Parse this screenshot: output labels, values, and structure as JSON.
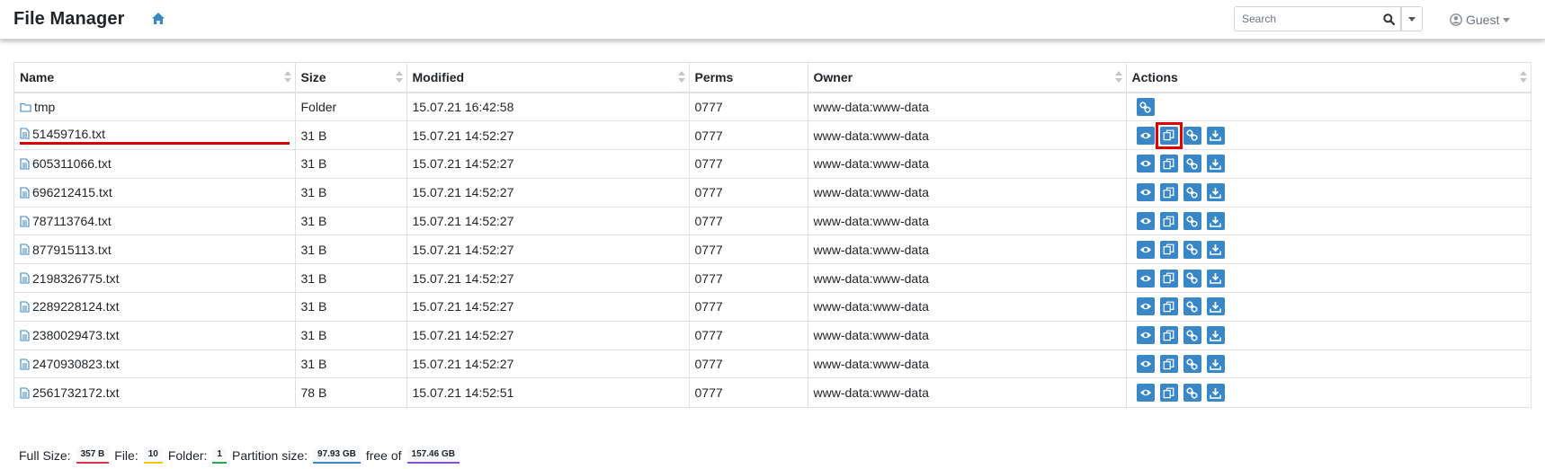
{
  "navbar": {
    "brand": "File Manager",
    "search_placeholder": "Search",
    "user_label": "Guest"
  },
  "table": {
    "headers": [
      "Name",
      "Size",
      "Modified",
      "Perms",
      "Owner",
      "Actions"
    ],
    "rows": [
      {
        "name": "tmp",
        "type": "folder",
        "size": "Folder",
        "modified": "15.07.21 16:42:58",
        "perms": "0777",
        "owner": "www-data:www-data"
      },
      {
        "name": "51459716.txt",
        "type": "file",
        "size": "31 B",
        "modified": "15.07.21 14:52:27",
        "perms": "0777",
        "owner": "www-data:www-data"
      },
      {
        "name": "605311066.txt",
        "type": "file",
        "size": "31 B",
        "modified": "15.07.21 14:52:27",
        "perms": "0777",
        "owner": "www-data:www-data"
      },
      {
        "name": "696212415.txt",
        "type": "file",
        "size": "31 B",
        "modified": "15.07.21 14:52:27",
        "perms": "0777",
        "owner": "www-data:www-data"
      },
      {
        "name": "787113764.txt",
        "type": "file",
        "size": "31 B",
        "modified": "15.07.21 14:52:27",
        "perms": "0777",
        "owner": "www-data:www-data"
      },
      {
        "name": "877915113.txt",
        "type": "file",
        "size": "31 B",
        "modified": "15.07.21 14:52:27",
        "perms": "0777",
        "owner": "www-data:www-data"
      },
      {
        "name": "2198326775.txt",
        "type": "file",
        "size": "31 B",
        "modified": "15.07.21 14:52:27",
        "perms": "0777",
        "owner": "www-data:www-data"
      },
      {
        "name": "2289228124.txt",
        "type": "file",
        "size": "31 B",
        "modified": "15.07.21 14:52:27",
        "perms": "0777",
        "owner": "www-data:www-data"
      },
      {
        "name": "2380029473.txt",
        "type": "file",
        "size": "31 B",
        "modified": "15.07.21 14:52:27",
        "perms": "0777",
        "owner": "www-data:www-data"
      },
      {
        "name": "2470930823.txt",
        "type": "file",
        "size": "31 B",
        "modified": "15.07.21 14:52:27",
        "perms": "0777",
        "owner": "www-data:www-data"
      },
      {
        "name": "2561732172.txt",
        "type": "file",
        "size": "78 B",
        "modified": "15.07.21 14:52:51",
        "perms": "0777",
        "owner": "www-data:www-data"
      }
    ]
  },
  "footer": {
    "full_size_label": "Full Size:",
    "full_size": "357 B",
    "file_label": "File:",
    "file_count": "10",
    "folder_label": "Folder:",
    "folder_count": "1",
    "partition_label": "Partition size:",
    "partition_free": "97.93 GB",
    "free_of_label": "free of",
    "partition_total": "157.46 GB"
  },
  "colors": {
    "accent": "#3a87c8",
    "highlight": "#e00000",
    "badge_full_size": "#dc3545",
    "badge_file": "#ffc107",
    "badge_folder": "#28a745",
    "badge_partition_free": "#3a87c8",
    "badge_partition_total": "#8a4fd8"
  }
}
